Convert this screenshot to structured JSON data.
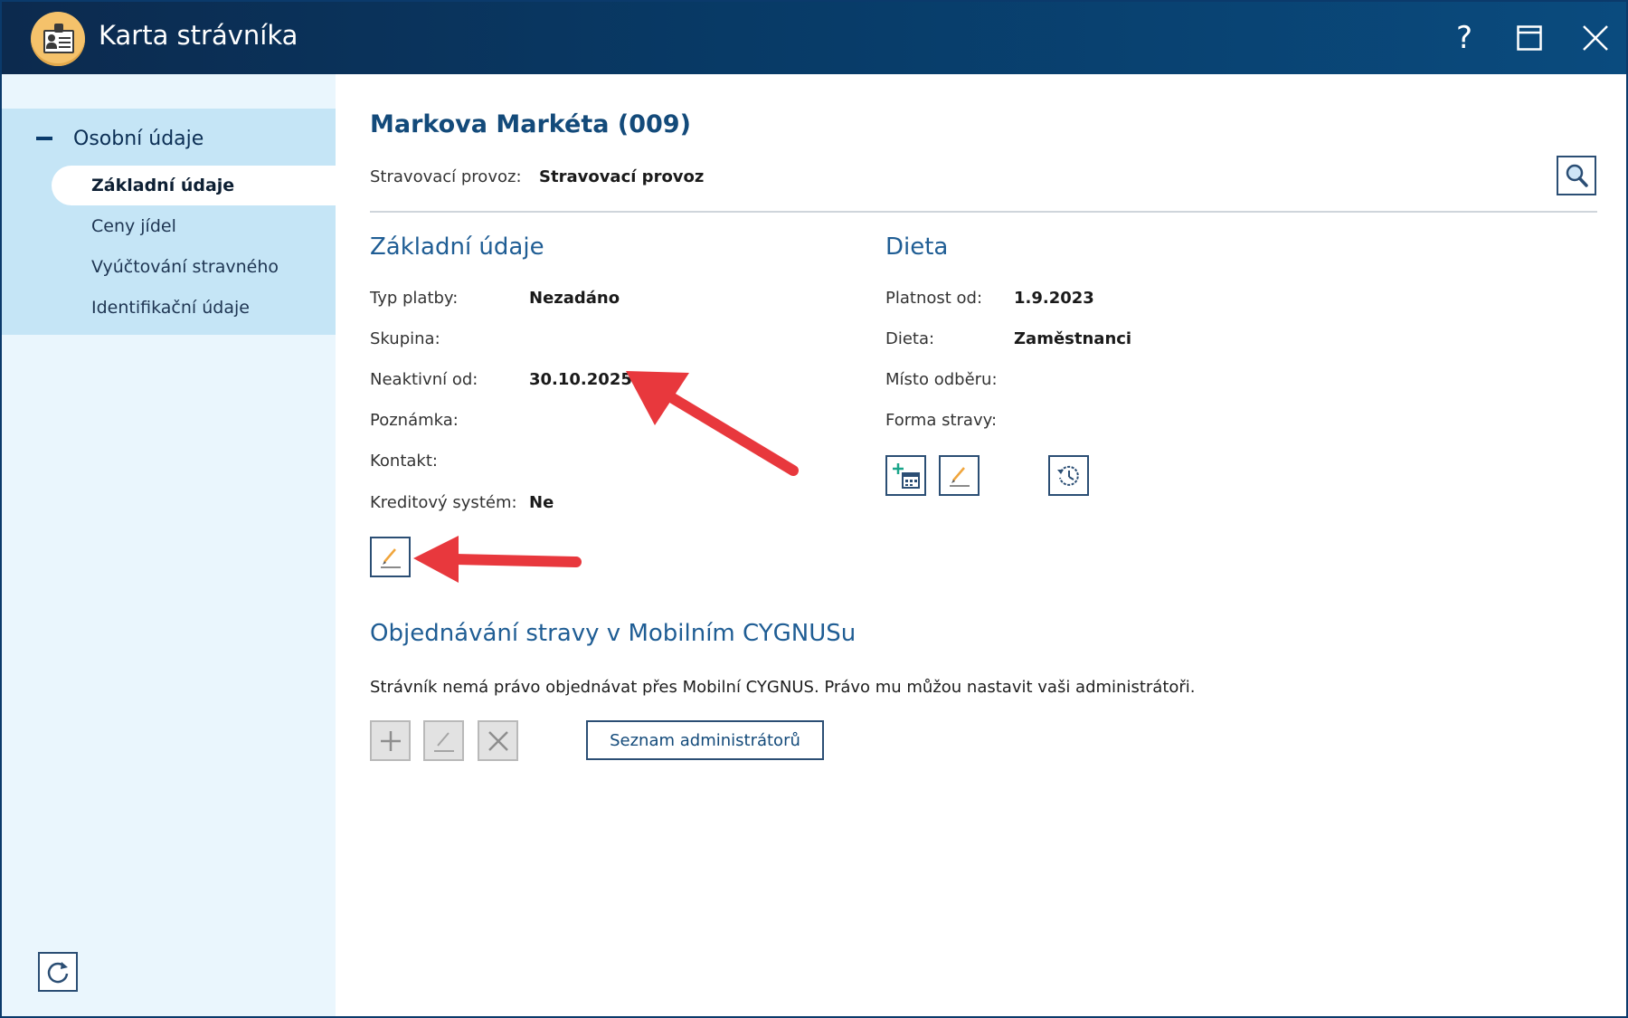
{
  "window": {
    "title": "Karta strávníka",
    "help_label": "?"
  },
  "sidebar": {
    "group_label": "Osobní údaje",
    "items": [
      {
        "label": "Základní údaje",
        "active": true
      },
      {
        "label": "Ceny jídel",
        "active": false
      },
      {
        "label": "Vyúčtování stravného",
        "active": false
      },
      {
        "label": "Identifikační údaje",
        "active": false
      }
    ]
  },
  "header": {
    "person_name": "Markova Markéta (009)",
    "provoz_label": "Stravovací provoz:",
    "provoz_value": "Stravovací provoz"
  },
  "zakladni": {
    "title": "Základní údaje",
    "fields": [
      {
        "label": "Typ platby:",
        "value": "Nezadáno"
      },
      {
        "label": "Skupina:",
        "value": ""
      },
      {
        "label": "Neaktivní od:",
        "value": "30.10.2025"
      },
      {
        "label": "Poznámka:",
        "value": ""
      },
      {
        "label": "Kontakt:",
        "value": ""
      },
      {
        "label": "Kreditový systém:",
        "value": "Ne"
      }
    ]
  },
  "dieta": {
    "title": "Dieta",
    "fields": [
      {
        "label": "Platnost od:",
        "value": "1.9.2023"
      },
      {
        "label": "Dieta:",
        "value": "Zaměstnanci"
      },
      {
        "label": "Místo odběru:",
        "value": ""
      },
      {
        "label": "Forma stravy:",
        "value": ""
      }
    ]
  },
  "mobile": {
    "title": "Objednávání stravy v Mobilním CYGNUSu",
    "info": "Strávník nemá právo objednávat přes Mobilní CYGNUS. Právo mu můžou nastavit vaši administrátoři.",
    "admins_button": "Seznam administrátorů"
  },
  "colors": {
    "titlebar": "#083a66",
    "accent": "#1f5d94",
    "sidebar_bg": "#eaf6fd",
    "sidebar_group": "#c5e5f6",
    "arrow": "#e8383d"
  }
}
